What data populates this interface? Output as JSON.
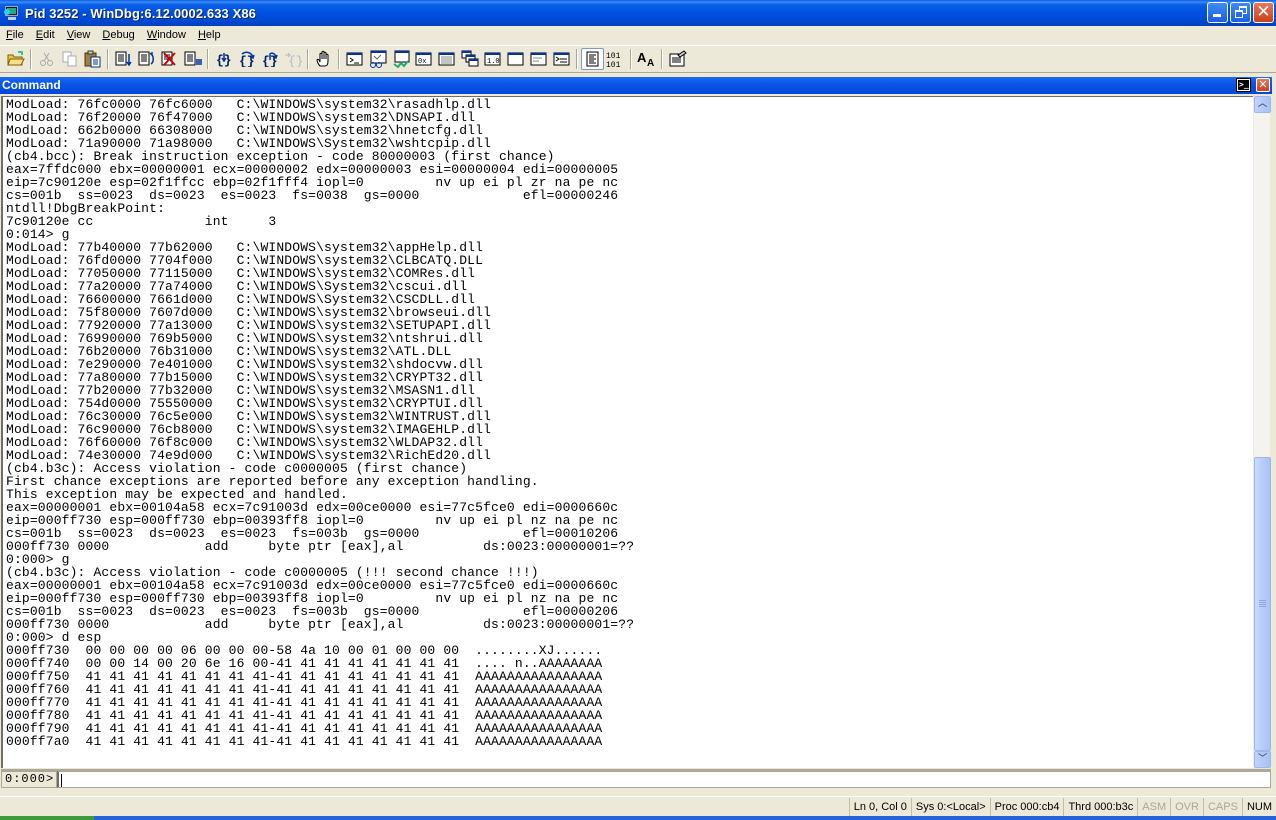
{
  "window": {
    "title": "Pid 3252 - WinDbg:6.12.0002.633 X86",
    "controls": [
      "minimize",
      "restore",
      "close"
    ]
  },
  "menu": [
    {
      "label": "File",
      "accel": "F"
    },
    {
      "label": "Edit",
      "accel": "E"
    },
    {
      "label": "View",
      "accel": "V"
    },
    {
      "label": "Debug",
      "accel": "D"
    },
    {
      "label": "Window",
      "accel": "W"
    },
    {
      "label": "Help",
      "accel": "H"
    }
  ],
  "toolbar": {
    "groups": [
      [
        "open-folder-icon"
      ],
      [
        "cut-icon",
        "copy-icon",
        "paste-icon"
      ],
      [
        "go-icon",
        "restart-icon",
        "stop-debugging-icon",
        "break-icon"
      ],
      [
        "step-into-icon",
        "step-over-icon",
        "step-out-icon",
        "run-to-cursor-icon"
      ],
      [
        "hand-icon"
      ],
      [
        "command-window-icon",
        "watch-window-icon",
        "locals-window-icon",
        "registers-window-icon",
        "memory-window-icon",
        "call-stack-icon",
        "disassembly-window-icon",
        "scratch-pad-icon",
        "processes-threads-icon",
        "command-browser-icon"
      ],
      [
        "source-mode-icon",
        "binary-mode-icon"
      ],
      [
        "font-icon"
      ],
      [
        "options-icon"
      ]
    ],
    "binary_mode_label": "101\n101",
    "font_label": "A"
  },
  "command_window": {
    "title": "Command",
    "lines": [
      "ModLoad: 76fc0000 76fc6000   C:\\WINDOWS\\system32\\rasadhlp.dll",
      "ModLoad: 76f20000 76f47000   C:\\WINDOWS\\system32\\DNSAPI.dll",
      "ModLoad: 662b0000 66308000   C:\\WINDOWS\\system32\\hnetcfg.dll",
      "ModLoad: 71a90000 71a98000   C:\\WINDOWS\\System32\\wshtcpip.dll",
      "(cb4.bcc): Break instruction exception - code 80000003 (first chance)",
      "eax=7ffdc000 ebx=00000001 ecx=00000002 edx=00000003 esi=00000004 edi=00000005",
      "eip=7c90120e esp=02f1ffcc ebp=02f1fff4 iopl=0         nv up ei pl zr na pe nc",
      "cs=001b  ss=0023  ds=0023  es=0023  fs=0038  gs=0000             efl=00000246",
      "ntdll!DbgBreakPoint:",
      "7c90120e cc              int     3",
      "0:014> g",
      "ModLoad: 77b40000 77b62000   C:\\WINDOWS\\system32\\appHelp.dll",
      "ModLoad: 76fd0000 7704f000   C:\\WINDOWS\\system32\\CLBCATQ.DLL",
      "ModLoad: 77050000 77115000   C:\\WINDOWS\\system32\\COMRes.dll",
      "ModLoad: 77a20000 77a74000   C:\\WINDOWS\\System32\\cscui.dll",
      "ModLoad: 76600000 7661d000   C:\\WINDOWS\\System32\\CSCDLL.dll",
      "ModLoad: 75f80000 7607d000   C:\\WINDOWS\\system32\\browseui.dll",
      "ModLoad: 77920000 77a13000   C:\\WINDOWS\\system32\\SETUPAPI.dll",
      "ModLoad: 76990000 769b5000   C:\\WINDOWS\\system32\\ntshrui.dll",
      "ModLoad: 76b20000 76b31000   C:\\WINDOWS\\system32\\ATL.DLL",
      "ModLoad: 7e290000 7e401000   C:\\WINDOWS\\system32\\shdocvw.dll",
      "ModLoad: 77a80000 77b15000   C:\\WINDOWS\\system32\\CRYPT32.dll",
      "ModLoad: 77b20000 77b32000   C:\\WINDOWS\\system32\\MSASN1.dll",
      "ModLoad: 754d0000 75550000   C:\\WINDOWS\\system32\\CRYPTUI.dll",
      "ModLoad: 76c30000 76c5e000   C:\\WINDOWS\\system32\\WINTRUST.dll",
      "ModLoad: 76c90000 76cb8000   C:\\WINDOWS\\system32\\IMAGEHLP.dll",
      "ModLoad: 76f60000 76f8c000   C:\\WINDOWS\\system32\\WLDAP32.dll",
      "ModLoad: 74e30000 74e9d000   C:\\WINDOWS\\system32\\RichEd20.dll",
      "(cb4.b3c): Access violation - code c0000005 (first chance)",
      "First chance exceptions are reported before any exception handling.",
      "This exception may be expected and handled.",
      "eax=00000001 ebx=00104a58 ecx=7c91003d edx=00ce0000 esi=77c5fce0 edi=0000660c",
      "eip=000ff730 esp=000ff730 ebp=00393ff8 iopl=0         nv up ei pl nz na pe nc",
      "cs=001b  ss=0023  ds=0023  es=0023  fs=003b  gs=0000             efl=00010206",
      "000ff730 0000            add     byte ptr [eax],al          ds:0023:00000001=??",
      "0:000> g",
      "(cb4.b3c): Access violation - code c0000005 (!!! second chance !!!)",
      "eax=00000001 ebx=00104a58 ecx=7c91003d edx=00ce0000 esi=77c5fce0 edi=0000660c",
      "eip=000ff730 esp=000ff730 ebp=00393ff8 iopl=0         nv up ei pl nz na pe nc",
      "cs=001b  ss=0023  ds=0023  es=0023  fs=003b  gs=0000             efl=00000206",
      "000ff730 0000            add     byte ptr [eax],al          ds:0023:00000001=??",
      "0:000> d esp",
      "000ff730  00 00 00 00 06 00 00 00-58 4a 10 00 01 00 00 00  ........XJ......",
      "000ff740  00 00 14 00 20 6e 16 00-41 41 41 41 41 41 41 41  .... n..AAAAAAAA",
      "000ff750  41 41 41 41 41 41 41 41-41 41 41 41 41 41 41 41  AAAAAAAAAAAAAAAA",
      "000ff760  41 41 41 41 41 41 41 41-41 41 41 41 41 41 41 41  AAAAAAAAAAAAAAAA",
      "000ff770  41 41 41 41 41 41 41 41-41 41 41 41 41 41 41 41  AAAAAAAAAAAAAAAA",
      "000ff780  41 41 41 41 41 41 41 41-41 41 41 41 41 41 41 41  AAAAAAAAAAAAAAAA",
      "000ff790  41 41 41 41 41 41 41 41-41 41 41 41 41 41 41 41  AAAAAAAAAAAAAAAA",
      "000ff7a0  41 41 41 41 41 41 41 41-41 41 41 41 41 41 41 41  AAAAAAAAAAAAAAAA"
    ],
    "scroll_position_fraction": 1.0,
    "prompt": "0:000>",
    "input_value": ""
  },
  "statusbar": {
    "position": "Ln 0, Col 0",
    "system": "Sys 0:<Local>",
    "process": "Proc 000:cb4",
    "thread": "Thrd 000:b3c",
    "asm": "ASM",
    "ovr": "OVR",
    "caps": "CAPS",
    "num": "NUM"
  },
  "colors": {
    "title_blue": "#0054e3",
    "face": "#ece9d8",
    "close_red": "#d9532c",
    "disabled_text": "#aca899"
  }
}
